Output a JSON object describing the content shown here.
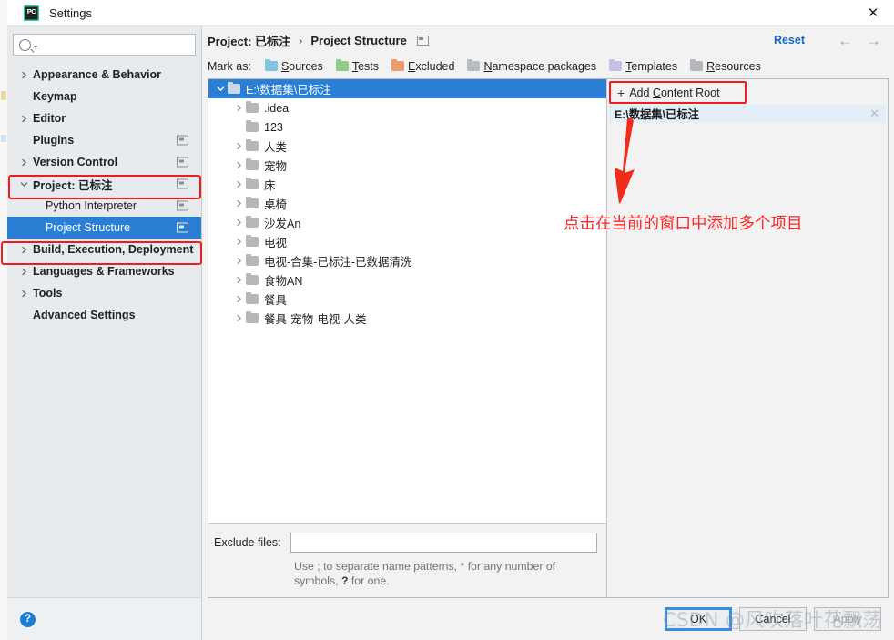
{
  "window": {
    "title": "Settings",
    "app_icon": "pycharm-logo-icon",
    "close_icon": "✕"
  },
  "sidebar": {
    "search": {
      "placeholder": "",
      "value": "",
      "icon": "search-icon"
    },
    "items": [
      {
        "label": "Appearance & Behavior",
        "chevron": true,
        "bold": true,
        "indented": false,
        "badge": false,
        "selected": false
      },
      {
        "label": "Keymap",
        "chevron": false,
        "bold": true,
        "indented": false,
        "badge": false,
        "selected": false
      },
      {
        "label": "Editor",
        "chevron": true,
        "bold": true,
        "indented": false,
        "badge": false,
        "selected": false
      },
      {
        "label": "Plugins",
        "chevron": false,
        "bold": true,
        "indented": false,
        "badge": true,
        "selected": false
      },
      {
        "label": "Version Control",
        "chevron": true,
        "bold": true,
        "indented": false,
        "badge": true,
        "selected": false
      },
      {
        "label": "Project: 已标注",
        "chevron": true,
        "expanded": true,
        "bold": true,
        "indented": false,
        "badge": true,
        "selected": false
      },
      {
        "label": "Python Interpreter",
        "chevron": false,
        "bold": false,
        "indented": true,
        "badge": true,
        "selected": false
      },
      {
        "label": "Project Structure",
        "chevron": false,
        "bold": false,
        "indented": true,
        "badge": true,
        "selected": true
      },
      {
        "label": "Build, Execution, Deployment",
        "chevron": true,
        "bold": true,
        "indented": false,
        "badge": false,
        "selected": false
      },
      {
        "label": "Languages & Frameworks",
        "chevron": true,
        "bold": true,
        "indented": false,
        "badge": false,
        "selected": false
      },
      {
        "label": "Tools",
        "chevron": true,
        "bold": true,
        "indented": false,
        "badge": false,
        "selected": false
      },
      {
        "label": "Advanced Settings",
        "chevron": false,
        "bold": true,
        "indented": false,
        "badge": false,
        "selected": false
      }
    ],
    "help_icon": "?"
  },
  "header": {
    "crumb_parent": "Project: 已标注",
    "crumb_sep": "›",
    "crumb_current": "Project Structure",
    "reset_label": "Reset",
    "back_arrow": "←",
    "forward_arrow": "→"
  },
  "markas": {
    "label": "Mark as:",
    "items": [
      {
        "text_before": "",
        "mnemonic": "S",
        "text_after": "ources",
        "color": "#7cc6e3",
        "icon": "folder-sources-icon"
      },
      {
        "text_before": "",
        "mnemonic": "T",
        "text_after": "ests",
        "color": "#8fcc8a",
        "icon": "folder-tests-icon"
      },
      {
        "text_before": "",
        "mnemonic": "E",
        "text_after": "xcluded",
        "color": "#ef9a6a",
        "icon": "folder-excluded-icon"
      },
      {
        "text_before": "",
        "mnemonic": "N",
        "text_after": "amespace packages",
        "color": "#b8bcc0",
        "icon": "folder-namespace-icon"
      },
      {
        "text_before": "",
        "mnemonic": "T",
        "text_after": "emplates",
        "color": "#c7bde8",
        "icon": "folder-templates-icon"
      },
      {
        "text_before": "",
        "mnemonic": "R",
        "text_after": "esources",
        "color": "#b3b7bb",
        "icon": "folder-resources-icon"
      }
    ]
  },
  "file_tree": [
    {
      "name": "E:\\数据集\\已标注",
      "level": 0,
      "chevron": "down",
      "selected": true
    },
    {
      "name": ".idea",
      "level": 1,
      "chevron": "right",
      "selected": false
    },
    {
      "name": "123",
      "level": 1,
      "chevron": "none",
      "selected": false
    },
    {
      "name": "人类",
      "level": 1,
      "chevron": "right",
      "selected": false
    },
    {
      "name": "宠物",
      "level": 1,
      "chevron": "right",
      "selected": false
    },
    {
      "name": "床",
      "level": 1,
      "chevron": "right",
      "selected": false
    },
    {
      "name": "桌椅",
      "level": 1,
      "chevron": "right",
      "selected": false
    },
    {
      "name": "沙发An",
      "level": 1,
      "chevron": "right",
      "selected": false
    },
    {
      "name": "电视",
      "level": 1,
      "chevron": "right",
      "selected": false
    },
    {
      "name": "电视-合集-已标注-已数据清洗",
      "level": 1,
      "chevron": "right",
      "selected": false
    },
    {
      "name": "食物AN",
      "level": 1,
      "chevron": "right",
      "selected": false
    },
    {
      "name": "餐具",
      "level": 1,
      "chevron": "right",
      "selected": false
    },
    {
      "name": "餐具-宠物-电视-人类",
      "level": 1,
      "chevron": "right",
      "selected": false
    }
  ],
  "exclude": {
    "label": "Exclude files:",
    "value": "",
    "placeholder": "",
    "hint_part1": "Use ; to separate name patterns, * for any number of symbols, ",
    "hint_bold": "?",
    "hint_part2": " for one.",
    "hint_full": "Use ; to separate name patterns, * for any number of symbols, ? for one."
  },
  "roots_panel": {
    "add_button_plus": "+",
    "add_button_label_before": "Add ",
    "add_button_mnemonic": "C",
    "add_button_label_after": "ontent Root",
    "add_button_full": "+ Add Content Root",
    "entry_path": "E:\\数据集\\已标注",
    "entry_close_icon": "✕"
  },
  "annotation": {
    "text": "点击在当前的窗口中添加多个项目",
    "color": "#fb2525",
    "arrow_icon": "red-down-arrow-icon"
  },
  "footer": {
    "ok_label": "OK",
    "cancel_label": "Cancel",
    "apply_label": "Apply"
  },
  "watermark": {
    "text": "CSDN @风吹落叶花飘荡"
  },
  "colors": {
    "accent_selection": "#2a7fd4",
    "annotation_red": "#ee1c1c",
    "link_blue": "#1668c1",
    "sidebar_bg": "#e7ebee"
  }
}
